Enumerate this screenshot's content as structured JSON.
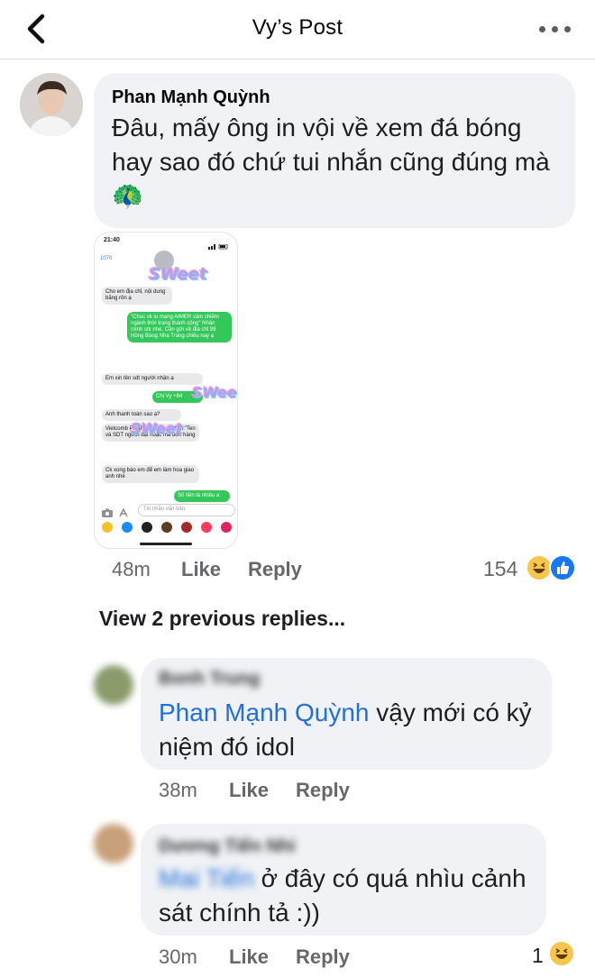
{
  "header": {
    "title": "Vy’s Post"
  },
  "comments": [
    {
      "author": "Phan Mạnh Quỳnh",
      "text": "Đâu, mấy ông in vội về xem đá bóng hay sao đó chứ tui nhắn cũng đúng mà",
      "emoji": "🦚",
      "time": "48m",
      "like_label": "Like",
      "reply_label": "Reply",
      "reaction_count": "154",
      "reactions": [
        "haha-icon",
        "like-icon"
      ],
      "attachment": {
        "status_time": "21:40",
        "back_label": "1070",
        "messages": [
          {
            "dir": "in",
            "text": "Cho em địa chỉ, nội dung băng rôn ạ"
          },
          {
            "dir": "out",
            "text": "\"Chúc vk iu mang AIMER xâm chiếm ngành thời trang thành công\" Nhân mình stk nhé. Cần gửi về địa chỉ 99 Hồng Bàng Nha Trang chiều nay ạ"
          },
          {
            "dir": "in",
            "text": "Em xin tên sdt người nhận ạ"
          },
          {
            "dir": "out",
            "text": "Chị Vy +84"
          },
          {
            "dir": "in",
            "text": "Anh thanh toán sao ạ?"
          },
          {
            "dir": "in",
            "text": "Vietcomb PHAN NG chuyển tiền:\"Ten và SDT người đặt hoặc mã đơn hàng"
          },
          {
            "dir": "in",
            "text": "Ck xong báo em để em làm hoa giao anh nhé"
          },
          {
            "dir": "out",
            "text": "Số tiền là nhiêu a"
          }
        ],
        "sticker_text": "SWeet",
        "input_placeholder": "Tin nhắn văn bản"
      }
    }
  ],
  "view_previous": "View 2 previous replies...",
  "replies": [
    {
      "author": "Bonh Trung",
      "mention": "Phan Mạnh Quỳnh",
      "text": " vậy mới có kỷ niệm đó idol",
      "time": "38m",
      "like_label": "Like",
      "reply_label": "Reply"
    },
    {
      "author": "Dương Tiến Nhi",
      "mention": "Mai Tiến",
      "text": " ở đây có quá nhìu cảnh sát chính tả :))",
      "time": "30m",
      "like_label": "Like",
      "reply_label": "Reply",
      "reaction_count": "1",
      "reactions": [
        "haha-icon"
      ]
    }
  ],
  "colors": {
    "bubble": "#f0f2f5",
    "mention": "#216fdb",
    "meta": "#65676b",
    "like_blue": "#1877f2",
    "haha_yellow": "#f7c64a"
  }
}
